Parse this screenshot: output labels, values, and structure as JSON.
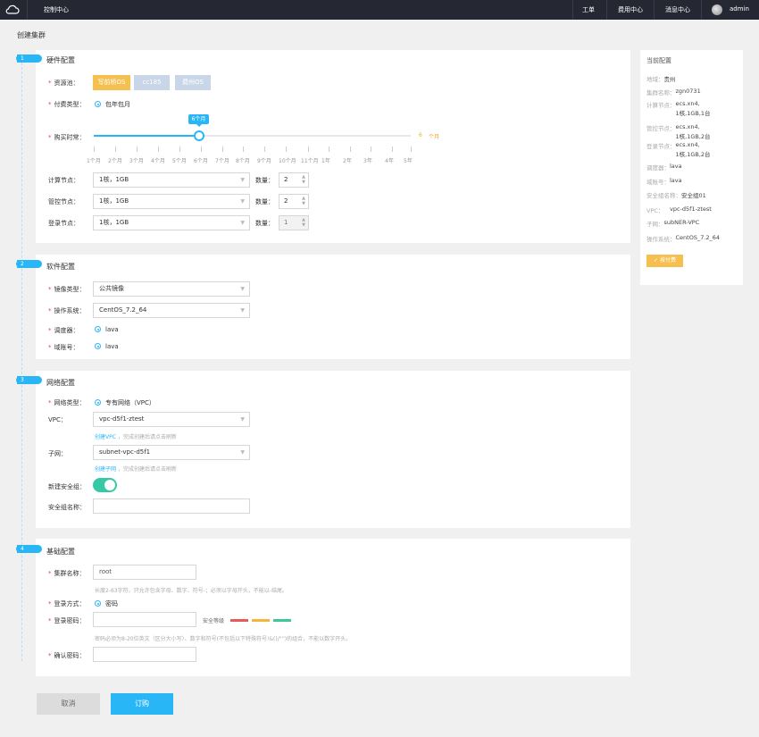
{
  "topbar": {
    "title": "控制中心",
    "nav": [
      "工单",
      "费用中心",
      "消息中心"
    ],
    "user": "admin"
  },
  "page_title": "创建集群",
  "sections": {
    "hardware": {
      "num": "1",
      "title": "硬件配置"
    },
    "software": {
      "num": "2",
      "title": "软件配置"
    },
    "network": {
      "num": "3",
      "title": "网络配置"
    },
    "basic": {
      "num": "4",
      "title": "基础配置"
    }
  },
  "hardware": {
    "pool_label": "资源池：",
    "pools": [
      "写前桥OS",
      "cc185",
      "费州OS"
    ],
    "pay_label": "付费类型：",
    "pay_value": "包年包月",
    "duration_label": "购买时常：",
    "duration_tip": "6个月",
    "duration_value": "6",
    "duration_unit": "个月",
    "ticks": [
      "1个月",
      "2个月",
      "3个月",
      "4个月",
      "5个月",
      "6个月",
      "7个月",
      "8个月",
      "9个月",
      "10个月",
      "11个月",
      "1年",
      "2年",
      "3年",
      "4年",
      "5年"
    ],
    "nodes": [
      {
        "label": "计算节点：",
        "spec": "1核，1GB",
        "qty_label": "数量：",
        "qty": "2"
      },
      {
        "label": "管控节点：",
        "spec": "1核，1GB",
        "qty_label": "数量：",
        "qty": "2"
      },
      {
        "label": "登录节点：",
        "spec": "1核，1GB",
        "qty_label": "数量：",
        "qty": "1"
      }
    ]
  },
  "software": {
    "image_label": "镜像类型：",
    "image_value": "公共镜像",
    "os_label": "操作系统：",
    "os_value": "CentOS_7.2_64",
    "scheduler_label": "调度器：",
    "scheduler_value": "lava",
    "domain_label": "域账号：",
    "domain_value": "lava"
  },
  "network": {
    "type_label": "网络类型：",
    "type_value": "专有网络（VPC）",
    "vpc_label": "VPC：",
    "vpc_value": "vpc-d5f1-ztest",
    "vpc_link": "创建VPC",
    "vpc_hint": "，完成创建后请点击刷新",
    "subnet_label": "子网：",
    "subnet_value": "subnet-vpc-d5f1",
    "subnet_link": "创建子网",
    "subnet_hint": "，完成创建后请点击刷新",
    "new_sg_label": "新建安全组：",
    "sg_name_label": "安全组名称："
  },
  "basic": {
    "cluster_label": "集群名称：",
    "cluster_value": "root",
    "cluster_hint": "长度2-63字符，只允许包含字母、数字、符号-；必须以字母开头，不能以-结尾。",
    "login_label": "登录方式：",
    "login_value": "密码",
    "pwd_label": "登录密码：",
    "strength_label": "安全等级",
    "pwd_hint": "密码必须为8-20位英文（区分大小写）、数字和符号(不包括以下特殊符号!&()/\"'')的组合，不能以数字开头。",
    "confirm_label": "确认密码："
  },
  "summary": {
    "title": "当前配置",
    "rows": [
      {
        "k": "地域：",
        "v": "贵州"
      },
      {
        "k": "集群名称：",
        "v": "zgn0731"
      },
      {
        "k": "计算节点：",
        "v": "ecs.xn4,",
        "v2": "1核,1GB,1台"
      },
      {
        "k": "管控节点：",
        "v": "ecs.xn4,",
        "v2": "1核,1GB,2台"
      },
      {
        "k": "登录节点：",
        "v": "ecs.xn4,",
        "v2": "1核,1GB,2台"
      },
      {
        "k": "调度器：",
        "v": "lava"
      },
      {
        "k": "域账号：",
        "v": "lava"
      },
      {
        "k": "安全组名称：",
        "v": "安全组01"
      },
      {
        "k": "VPC：",
        "v": "vpc-d5f1-ztest"
      },
      {
        "k": "子网：",
        "v": "subNER-VPC"
      },
      {
        "k": "操作系统：",
        "v": "CentOS_7.2_64"
      }
    ],
    "pay_button": "按付费"
  },
  "actions": {
    "cancel": "取消",
    "submit": "订购"
  },
  "colors": {
    "accent": "#29b6f6",
    "pool_active": "#f5c04f",
    "pool_inactive": "#c9d6e8",
    "toggle": "#37c8a7",
    "strength": [
      "#e85a5a",
      "#f5b43a",
      "#3ec79a"
    ]
  }
}
